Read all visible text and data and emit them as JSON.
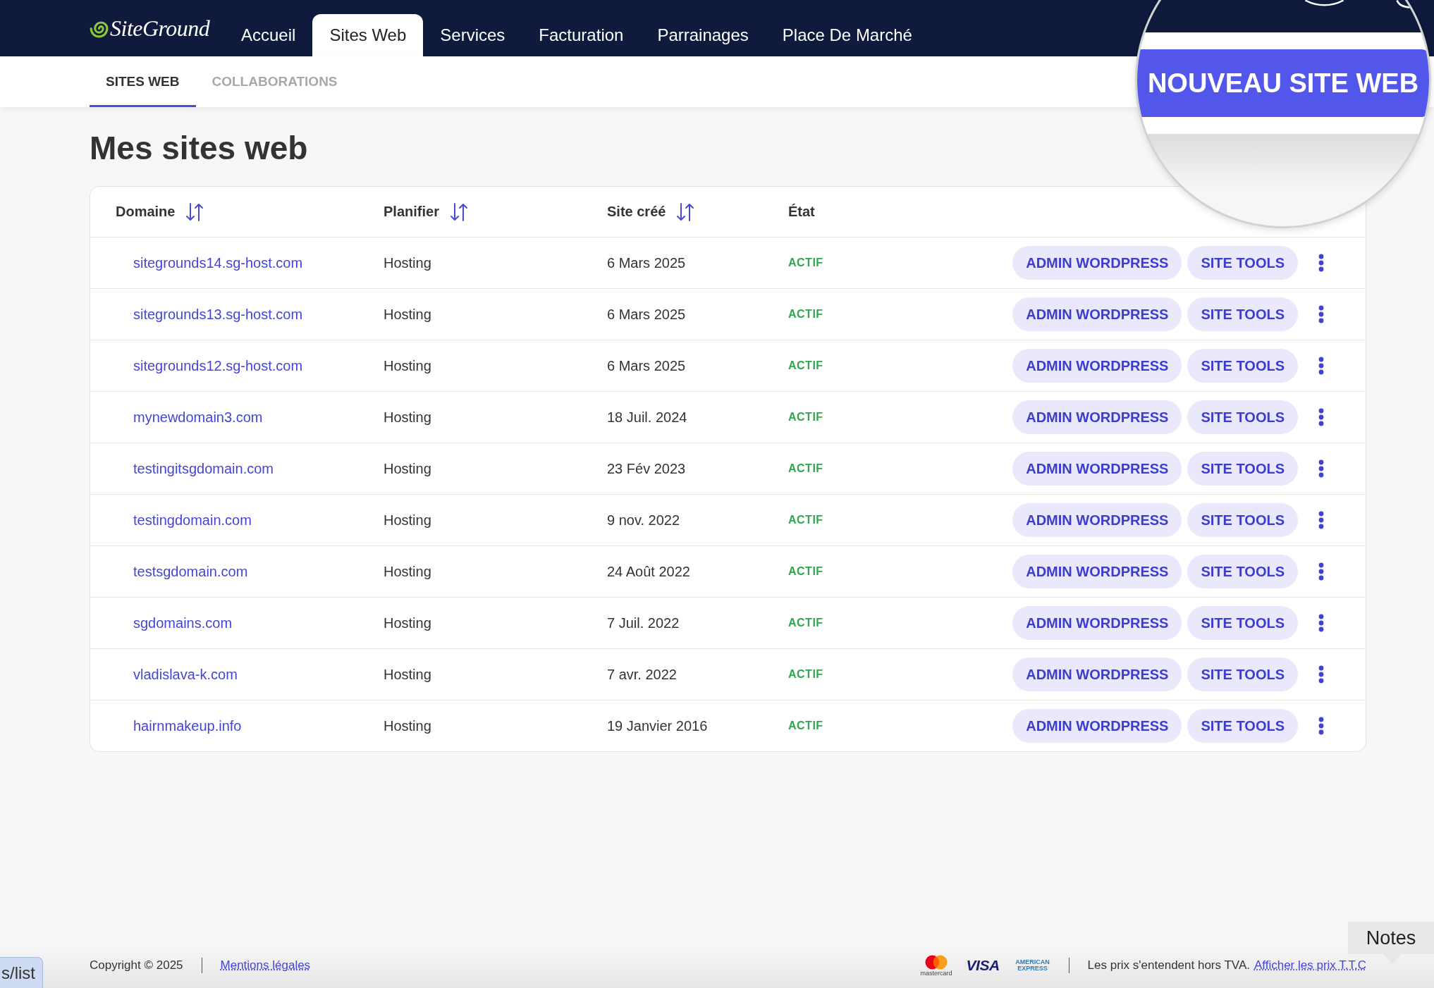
{
  "header": {
    "logo": "SiteGround",
    "nav": [
      {
        "label": "Accueil",
        "selected": false
      },
      {
        "label": "Sites Web",
        "selected": true
      },
      {
        "label": "Services",
        "selected": false
      },
      {
        "label": "Facturation",
        "selected": false
      },
      {
        "label": "Parrainages",
        "selected": false
      },
      {
        "label": "Place De Marché",
        "selected": false
      }
    ]
  },
  "subnav": {
    "tabs": [
      {
        "label": "SITES WEB",
        "selected": true
      },
      {
        "label": "COLLABORATIONS",
        "selected": false
      }
    ]
  },
  "magnifier": {
    "button": "NOUVEAU SITE WEB"
  },
  "page_title": "Mes sites web",
  "table": {
    "columns": [
      {
        "label": "Domaine",
        "sortable": true
      },
      {
        "label": "Planifier",
        "sortable": true
      },
      {
        "label": "Site créé",
        "sortable": true
      },
      {
        "label": "État",
        "sortable": false
      }
    ],
    "rows": [
      {
        "domain": "sitegrounds14.sg-host.com",
        "plan": "Hosting",
        "created": "6 Mars 2025",
        "status": "ACTIF",
        "actions": [
          "ADMIN WORDPRESS",
          "SITE TOOLS"
        ]
      },
      {
        "domain": "sitegrounds13.sg-host.com",
        "plan": "Hosting",
        "created": "6 Mars 2025",
        "status": "ACTIF",
        "actions": [
          "ADMIN WORDPRESS",
          "SITE TOOLS"
        ]
      },
      {
        "domain": "sitegrounds12.sg-host.com",
        "plan": "Hosting",
        "created": "6 Mars 2025",
        "status": "ACTIF",
        "actions": [
          "ADMIN WORDPRESS",
          "SITE TOOLS"
        ]
      },
      {
        "domain": "mynewdomain3.com",
        "plan": "Hosting",
        "created": "18 Juil. 2024",
        "status": "ACTIF",
        "actions": [
          "ADMIN WORDPRESS",
          "SITE TOOLS"
        ]
      },
      {
        "domain": "testingitsgdomain.com",
        "plan": "Hosting",
        "created": "23 Fév 2023",
        "status": "ACTIF",
        "actions": [
          "ADMIN WORDPRESS",
          "SITE TOOLS"
        ]
      },
      {
        "domain": "testingdomain.com",
        "plan": "Hosting",
        "created": "9 nov. 2022",
        "status": "ACTIF",
        "actions": [
          "ADMIN WORDPRESS",
          "SITE TOOLS"
        ]
      },
      {
        "domain": "testsgdomain.com",
        "plan": "Hosting",
        "created": "24 Août 2022",
        "status": "ACTIF",
        "actions": [
          "ADMIN WORDPRESS",
          "SITE TOOLS"
        ]
      },
      {
        "domain": "sgdomains.com",
        "plan": "Hosting",
        "created": "7 Juil. 2022",
        "status": "ACTIF",
        "actions": [
          "ADMIN WORDPRESS",
          "SITE TOOLS"
        ]
      },
      {
        "domain": "vladislava-k.com",
        "plan": "Hosting",
        "created": "7 avr. 2022",
        "status": "ACTIF",
        "actions": [
          "ADMIN WORDPRESS",
          "SITE TOOLS"
        ]
      },
      {
        "domain": "hairnmakeup.info",
        "plan": "Hosting",
        "created": "19 Janvier 2016",
        "status": "ACTIF",
        "actions": [
          "ADMIN WORDPRESS",
          "SITE TOOLS"
        ]
      }
    ]
  },
  "footer": {
    "copyright": "Copyright © 2025",
    "legal_link": "Mentions légales",
    "payment_methods": [
      {
        "kind": "mastercard",
        "label": "mastercard"
      },
      {
        "kind": "visa",
        "label": "VISA"
      },
      {
        "kind": "amex",
        "label": "AMERICAN EXPRESS"
      }
    ],
    "tax_note": "Les prix s'entendent hors TVA.",
    "tax_link": "Afficher les prix T.T.C"
  },
  "overlays": {
    "url_hint": "s/list",
    "notes_tooltip": "Notes"
  }
}
